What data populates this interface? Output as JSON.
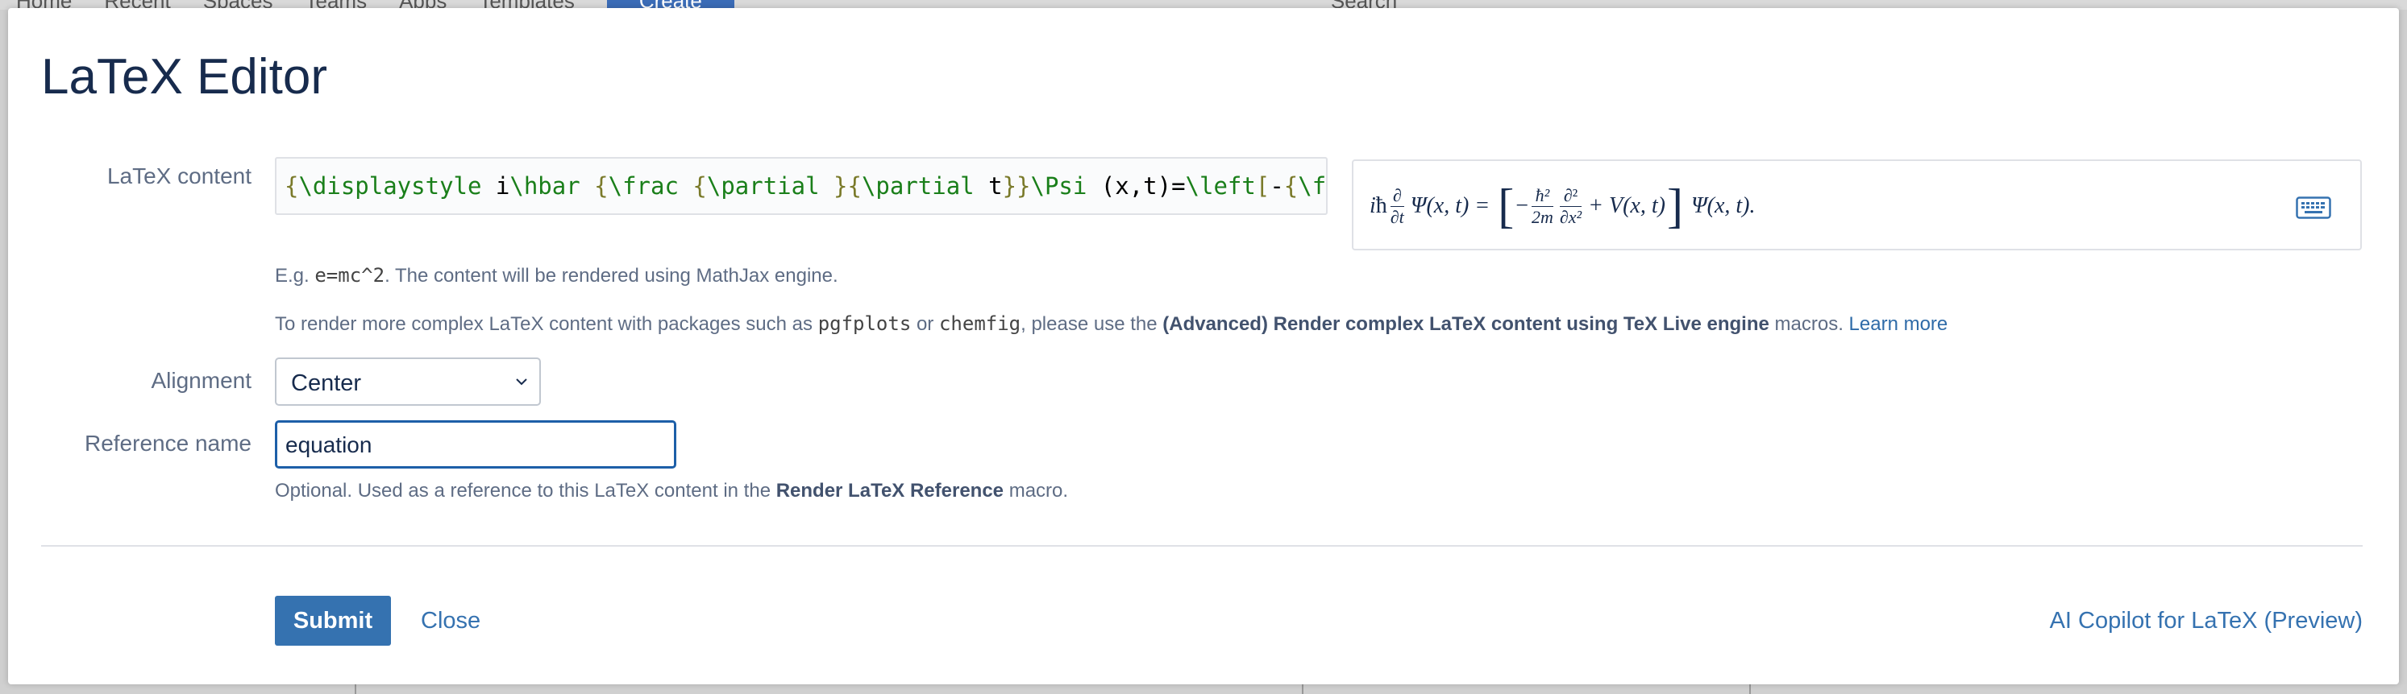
{
  "background_nav": {
    "items": [
      "Home",
      "Recent",
      "Spaces",
      "Teams",
      "Apps",
      "Templates"
    ],
    "create_label": "Create",
    "search_placeholder": "Search"
  },
  "dialog": {
    "title": "LaTeX Editor",
    "latex_content_label": "LaTeX content",
    "latex_value": "{\\displaystyle i\\hbar {\\frac {\\partial }{\\partial t}}\\Psi (x,t)=\\left[-{\\fra",
    "latex_tokens": [
      {
        "t": "{",
        "c": "brace"
      },
      {
        "t": "\\displaystyle",
        "c": "cmd"
      },
      {
        "t": " i",
        "c": "txt"
      },
      {
        "t": "\\hbar",
        "c": "cmd"
      },
      {
        "t": " ",
        "c": "txt"
      },
      {
        "t": "{",
        "c": "brace"
      },
      {
        "t": "\\frac",
        "c": "cmd"
      },
      {
        "t": " ",
        "c": "txt"
      },
      {
        "t": "{",
        "c": "brace"
      },
      {
        "t": "\\partial",
        "c": "cmd"
      },
      {
        "t": " ",
        "c": "txt"
      },
      {
        "t": "}{",
        "c": "brace"
      },
      {
        "t": "\\partial",
        "c": "cmd"
      },
      {
        "t": " t",
        "c": "txt"
      },
      {
        "t": "}}",
        "c": "brace"
      },
      {
        "t": "\\Psi",
        "c": "cmd"
      },
      {
        "t": " (x,t)=",
        "c": "txt"
      },
      {
        "t": "\\left",
        "c": "cmd"
      },
      {
        "t": "[",
        "c": "brace"
      },
      {
        "t": "-",
        "c": "txt"
      },
      {
        "t": "{",
        "c": "brace"
      },
      {
        "t": "\\fra",
        "c": "cmd"
      }
    ],
    "hint_example_prefix": "E.g. ",
    "hint_example_code": "e=mc^2",
    "hint_example_suffix": ". The content will be rendered using MathJax engine.",
    "hint_complex_prefix": "To render more complex LaTeX content with packages such as ",
    "hint_complex_pkg1": "pgfplots",
    "hint_complex_or": " or ",
    "hint_complex_pkg2": "chemfig",
    "hint_complex_mid": ", please use the ",
    "hint_complex_bold": "(Advanced) Render complex LaTeX content using TeX Live engine",
    "hint_complex_suffix": " macros. ",
    "learn_more_link": "Learn more",
    "alignment_label": "Alignment",
    "alignment_value": "Center",
    "reference_label": "Reference name",
    "reference_value": "equation",
    "reference_hint_prefix": "Optional. Used as a reference to this LaTeX content in the ",
    "reference_hint_bold": "Render LaTeX Reference",
    "reference_hint_suffix": " macro.",
    "submit_label": "Submit",
    "close_label": "Close",
    "ai_copilot_label": "AI Copilot for LaTeX (Preview)"
  },
  "preview": {
    "lhs_i": "i",
    "lhs_hbar": "ħ",
    "d_top": "∂",
    "d_bot_t": "∂t",
    "psi_lhs": "Ψ(x, t) =",
    "minus": "−",
    "hbar2": "ħ²",
    "two_m": "2m",
    "d2": "∂²",
    "dx2": "∂x²",
    "plus_v": "+ V(x, t)",
    "psi_rhs": "Ψ(x, t)."
  },
  "colors": {
    "accent": "#3572b0",
    "focus_border": "#1d5fa8",
    "label_text": "#5e6c84",
    "title_text": "#172b4d"
  },
  "icons": [
    "keyboard-icon",
    "chevron-down-icon"
  ]
}
